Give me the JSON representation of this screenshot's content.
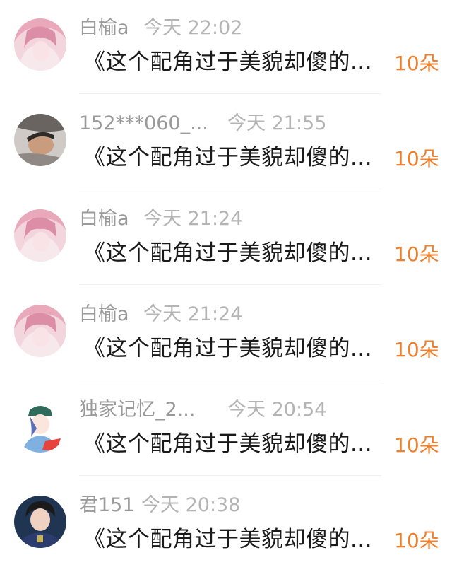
{
  "colors": {
    "name": "#9a9a9a",
    "time": "#b4b4b4",
    "title": "#1a1a1a",
    "count": "#ee7f2d",
    "divider": "#f0f0f0"
  },
  "items": [
    {
      "name": "白榆a",
      "time": "今天 22:02",
      "title": "《这个配角过于美貌却傻的...",
      "count": "10朵",
      "avatar": "pink-hair-avatar"
    },
    {
      "name": "152***060_...",
      "time": "今天 21:55",
      "title": "《这个配角过于美貌却傻的...",
      "count": "10朵",
      "avatar": "sleeping-person-avatar"
    },
    {
      "name": "白榆a",
      "time": "今天 21:24",
      "title": "《这个配角过于美貌却傻的...",
      "count": "10朵",
      "avatar": "pink-hair-avatar"
    },
    {
      "name": "白榆a",
      "time": "今天 21:24",
      "title": "《这个配角过于美貌却傻的...",
      "count": "10朵",
      "avatar": "pink-hair-avatar"
    },
    {
      "name": "独家记忆_2...",
      "time": "今天 20:54",
      "title": "《这个配角过于美貌却傻的...",
      "count": "10朵",
      "avatar": "cartoon-cap-avatar"
    },
    {
      "name": "君151",
      "time": "今天 20:38",
      "title": "《这个配角过于美貌却傻的...",
      "count": "10朵",
      "avatar": "young-man-avatar"
    }
  ]
}
